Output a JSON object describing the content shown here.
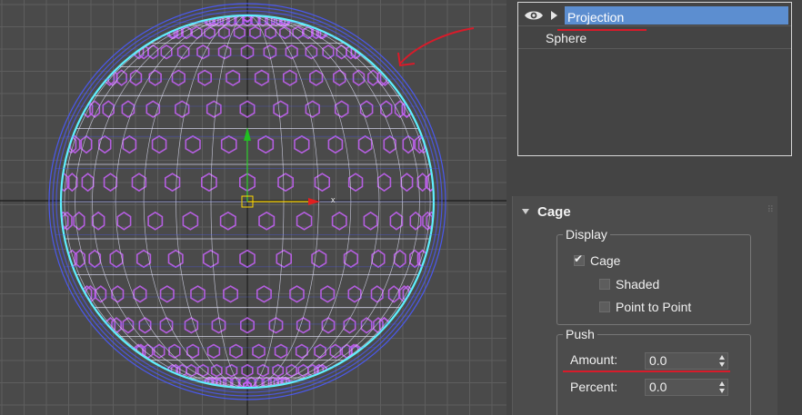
{
  "modifier_stack": {
    "items": [
      {
        "label": "Projection",
        "selected": true,
        "visible_icon": "eye-icon",
        "expand_icon": "play-triangle-icon"
      },
      {
        "label": "Sphere",
        "selected": false
      }
    ]
  },
  "cage_rollout": {
    "title": "Cage",
    "display_group": {
      "label": "Display",
      "cage": {
        "label": "Cage",
        "checked": true
      },
      "shaded": {
        "label": "Shaded",
        "checked": false
      },
      "point_to_point": {
        "label": "Point to Point",
        "checked": false
      }
    },
    "push_group": {
      "label": "Push",
      "amount": {
        "label": "Amount:",
        "value": "0.0"
      },
      "percent": {
        "label": "Percent:",
        "value": "0.0"
      }
    }
  },
  "viewport": {
    "gizmo_axis_label": "x",
    "colors": {
      "background": "#4a4a4a",
      "grid": "#5e5e5e",
      "cage_blue": "#4a5aff",
      "cage_cyan": "#5ef0ff",
      "mesh_purple": "#c060f0",
      "wire_white": "#e8e8ff",
      "annotation_red": "#d81b2a"
    }
  }
}
